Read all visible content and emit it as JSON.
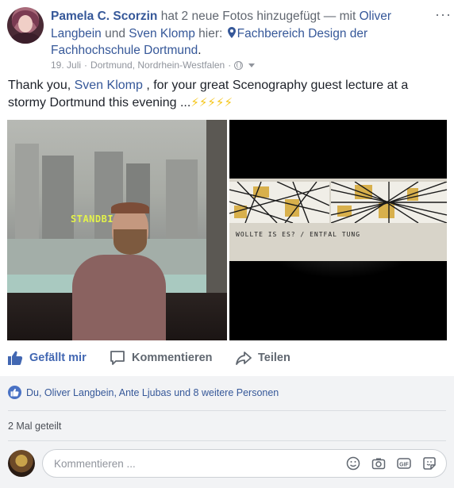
{
  "post": {
    "author": "Pamela C. Scorzin",
    "action_text": " hat 2 neue Fotos hinzugefügt — mit ",
    "tagged_1": "Oliver Langbein",
    "and_text": " und ",
    "tagged_2": "Sven Klomp",
    "here_text": " hier: ",
    "location": "Fachbereich Design der Fachhochschule Dortmund",
    "period": ".",
    "date": "19. Juli",
    "separator": "·",
    "place": "Dortmund, Nordrhein-Westfalen",
    "privacy_icon": "globe-icon",
    "more_icon": "more-options-icon",
    "more_label": "···",
    "text_before": "Thank you, ",
    "text_mention": "Sven Klomp",
    "text_after": " , for your great Scenography guest lecture at a stormy Dortmund this evening ...",
    "emoji": "⚡⚡⚡⚡⚡"
  },
  "photos": {
    "left": {
      "projection_text": "STANDBI"
    },
    "right": {
      "sketch_text": "WOLLTE IS ES? / ENTFAL  TUNG"
    }
  },
  "actions": {
    "like_label": "Gefällt mir",
    "comment_label": "Kommentieren",
    "share_label": "Teilen"
  },
  "reactions": {
    "text": "Du, Oliver Langbein, Ante Ljubas und 8 weitere Personen"
  },
  "shares": {
    "text": "2 Mal geteilt"
  },
  "comment_box": {
    "placeholder": "Kommentieren ...",
    "icons": [
      "emoji-icon",
      "camera-icon",
      "gif-icon",
      "sticker-icon"
    ]
  },
  "colors": {
    "link": "#365899",
    "like_blue": "#4267b2",
    "muted": "#90949c",
    "bolt": "#f5c518"
  }
}
